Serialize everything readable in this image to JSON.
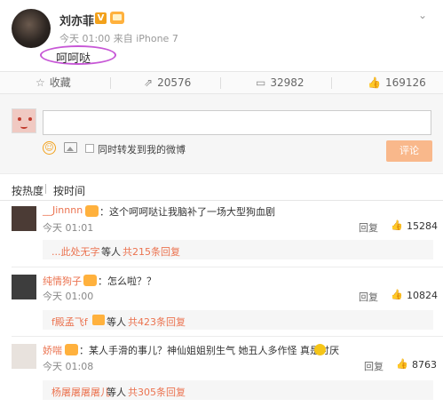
{
  "post": {
    "author": "刘亦菲",
    "vip_badge": "V",
    "meta": "今天 01:00 来自 iPhone 7",
    "text": "呵呵哒",
    "menu_icon": "chevron-down-icon"
  },
  "actions": {
    "favorite": "收藏",
    "repost": "20576",
    "comment": "32982",
    "like": "169126"
  },
  "compose": {
    "input_value": "",
    "repost_label": "同时转发到我的微博",
    "submit": "评论"
  },
  "sort": {
    "hot": "按热度",
    "time": "按时间"
  },
  "comments": [
    {
      "name": "__Jinnnn",
      "text": "：这个呵呵哒让我脑补了一场大型狗血剧",
      "time": "今天 01:01",
      "reply": "回复",
      "likes": "15284",
      "sub_user": "...此处无字",
      "sub_mid": "等人",
      "sub_count": "共215条回复"
    },
    {
      "name": "纯情狗子",
      "text": "：怎么啦？？",
      "time": "今天 01:00",
      "reply": "回复",
      "likes": "10824",
      "sub_user": "f殿孟飞f",
      "sub_mid": "等人",
      "sub_count": "共423条回复"
    },
    {
      "name": "娇喘",
      "text": "：某人手滑的事儿？神仙姐姐别生气 她丑人多作怪 真是讨厌",
      "time": "今天 01:08",
      "reply": "回复",
      "likes": "8763",
      "sub_user": "杨屠屠屠屠儿",
      "sub_mid": "等人",
      "sub_count": "共305条回复"
    }
  ],
  "colors": {
    "accent_orange": "#eb7350",
    "highlight_purple": "#c757d6",
    "submit_bg": "#f9b88b"
  }
}
